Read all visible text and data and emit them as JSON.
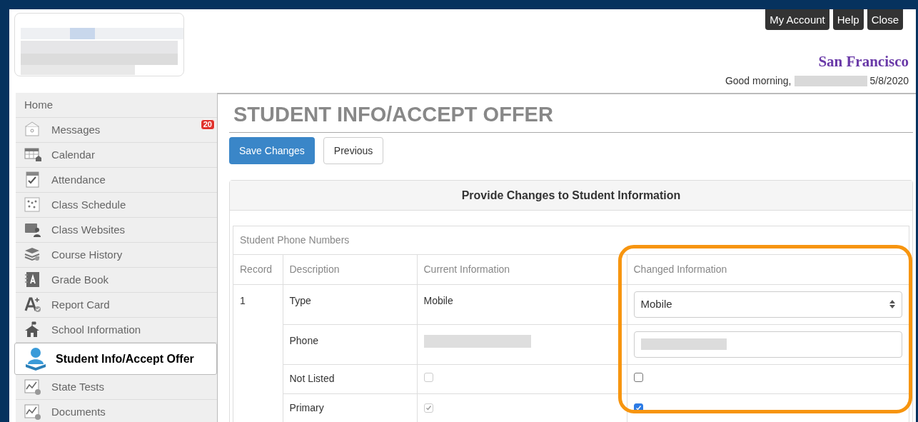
{
  "header": {
    "buttons": [
      "My Account",
      "Help",
      "Close"
    ],
    "school": "San Francisco",
    "greeting": "Good morning,",
    "date": "5/8/2020"
  },
  "sidebar": {
    "items": [
      {
        "label": "Home",
        "selected": false
      },
      {
        "label": "Messages",
        "selected": false,
        "badge": "20"
      },
      {
        "label": "Calendar",
        "selected": false
      },
      {
        "label": "Attendance",
        "selected": false
      },
      {
        "label": "Class Schedule",
        "selected": false
      },
      {
        "label": "Class Websites",
        "selected": false
      },
      {
        "label": "Course History",
        "selected": false
      },
      {
        "label": "Grade Book",
        "selected": false
      },
      {
        "label": "Report Card",
        "selected": false
      },
      {
        "label": "School Information",
        "selected": false
      },
      {
        "label": "Student Info/Accept Offer",
        "selected": true
      },
      {
        "label": "State Tests",
        "selected": false
      },
      {
        "label": "Documents",
        "selected": false
      }
    ]
  },
  "main": {
    "title": "STUDENT INFO/ACCEPT OFFER",
    "buttons": [
      "Save Changes",
      "Previous"
    ],
    "panel": {
      "title": "Provide Changes to Student Information",
      "section": "Student Phone Numbers",
      "columns": [
        "Record",
        "Description",
        "Current Information",
        "Changed Information"
      ],
      "record": "1",
      "rows": [
        {
          "kind": "select",
          "description": "Type",
          "current": "Mobile",
          "changed": "Mobile"
        },
        {
          "kind": "redacted",
          "description": "Phone"
        },
        {
          "kind": "checkbox",
          "description": "Not Listed",
          "current_checked": false,
          "changed_checked": false
        },
        {
          "kind": "checkbox",
          "description": "Primary",
          "current_checked": true,
          "changed_checked": true
        }
      ]
    }
  }
}
